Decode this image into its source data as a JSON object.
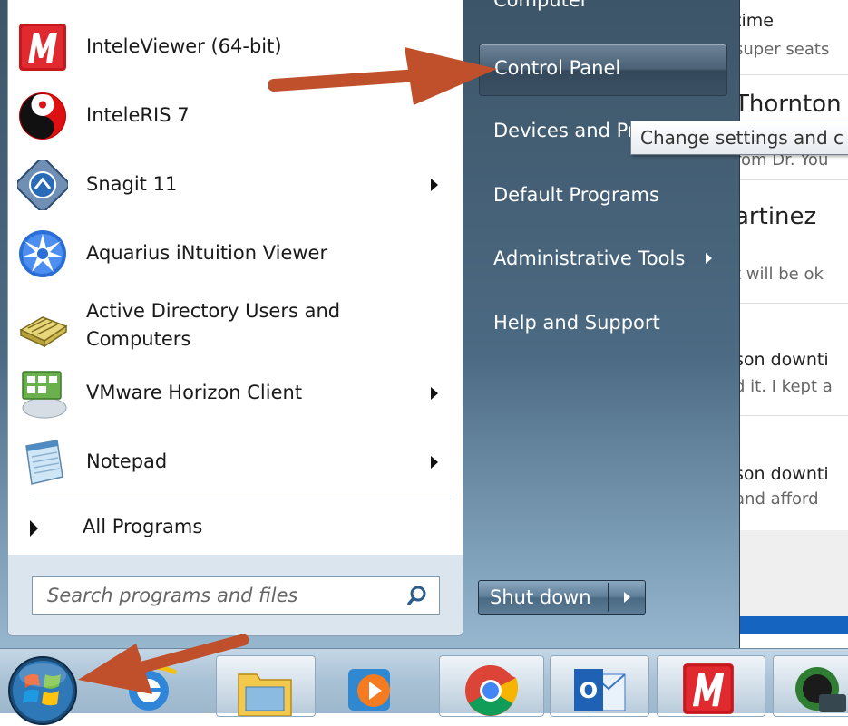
{
  "background_window": {
    "lines": [
      {
        "text": "time",
        "kind": "normal"
      },
      {
        "text": "super seats",
        "kind": "sub"
      },
      {
        "text": "Thornton",
        "kind": "big"
      },
      {
        "text": "rom Dr. You",
        "kind": "sub"
      },
      {
        "text": "artinez",
        "kind": "big"
      },
      {
        "text": "t will be ok",
        "kind": "sub"
      },
      {
        "text": "son downti",
        "kind": "normal"
      },
      {
        "text": "d it.  I kept a",
        "kind": "sub"
      },
      {
        "text": "son downti",
        "kind": "normal"
      },
      {
        "text": "and afford",
        "kind": "sub"
      }
    ]
  },
  "start_menu": {
    "programs": [
      {
        "label": "InteleViewer (64-bit)",
        "icon": "inteleviewer-icon",
        "submenu": false
      },
      {
        "label": "InteleRIS 7",
        "icon": "yin-yang-icon",
        "submenu": false
      },
      {
        "label": "Snagit 11",
        "icon": "snagit-icon",
        "submenu": true
      },
      {
        "label": "Aquarius iNtuition Viewer",
        "icon": "aquarius-star-icon",
        "submenu": false
      },
      {
        "label_line1": "Active Directory Users and",
        "label_line2": "Computers",
        "icon": "address-book-icon",
        "submenu": false
      },
      {
        "label": "VMware Horizon Client",
        "icon": "vmware-horizon-icon",
        "submenu": true
      },
      {
        "label": "Notepad",
        "icon": "notepad-icon",
        "submenu": true
      }
    ],
    "all_programs_label": "All Programs",
    "search_placeholder": "Search programs and files",
    "right_pane": {
      "computer_label": "Computer",
      "items": [
        {
          "label": "Control Panel",
          "highlighted": true,
          "submenu": false
        },
        {
          "label": "Devices and Pr",
          "submenu": false
        },
        {
          "label": "Default Programs",
          "submenu": false
        },
        {
          "label": "Administrative Tools",
          "submenu": true
        },
        {
          "label": "Help and Support",
          "submenu": false
        }
      ]
    },
    "shutdown_label": "Shut down",
    "tooltip": "Change settings and c"
  },
  "taskbar": {
    "items": [
      "start-orb",
      "internet-explorer-icon",
      "file-explorer-icon",
      "media-player-icon",
      "chrome-icon",
      "outlook-icon",
      "inteleviewer-icon",
      "remote-desktop-icon"
    ]
  },
  "colors": {
    "annotation_arrow": "#c0502c",
    "start_menu_panel": "#4c6a83",
    "taskbar": "#a9c1d5"
  }
}
